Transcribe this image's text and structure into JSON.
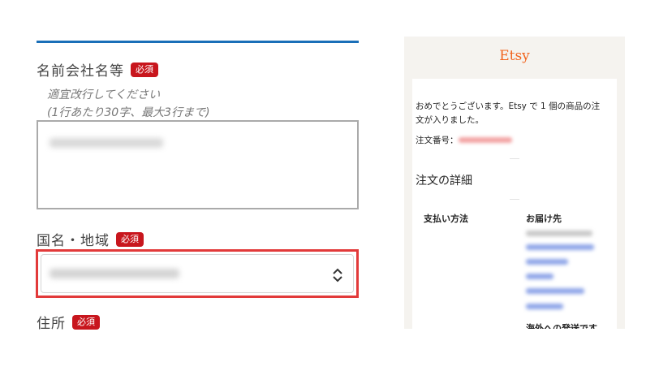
{
  "form": {
    "name_field": {
      "label": "名前会社名等",
      "required_badge": "必須",
      "hint_line1": "適宜改行してください",
      "hint_line2": "(1行あたり30字、最大3行まで)"
    },
    "country_field": {
      "label": "国名・地域",
      "required_badge": "必須"
    },
    "address_field": {
      "label": "住所",
      "required_badge": "必須"
    },
    "accent_color": "#1a6fb8",
    "required_color": "#c8161d",
    "highlight_color": "#e23a3a"
  },
  "email": {
    "brand": "Etsy",
    "brand_color": "#f1641e",
    "message": "おめでとうございます。Etsy で 1 個の商品の注文が入りました。",
    "order_number_label": "注文番号：",
    "details_title": "注文の詳細",
    "payment_label": "支払い方法",
    "shipping_label": "お届け先",
    "cut_off_text": "海外への発送です"
  },
  "icons": {
    "select_arrow": "chevron-updown-icon"
  }
}
